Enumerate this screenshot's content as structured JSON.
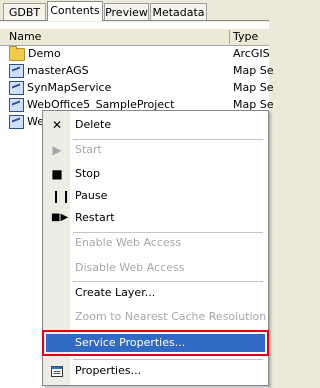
{
  "tabs": [
    {
      "label": "GDBT"
    },
    {
      "label": "Contents"
    },
    {
      "label": "Preview"
    },
    {
      "label": "Metadata"
    }
  ],
  "active_tab": "Contents",
  "columns": {
    "name": "Name",
    "type": "Type"
  },
  "rows": [
    {
      "name": "Demo",
      "type": "ArcGIS",
      "icon": "folder-icon"
    },
    {
      "name": "masterAGS",
      "type": "Map Se",
      "icon": "map-service-icon"
    },
    {
      "name": "SynMapService",
      "type": "Map Se",
      "icon": "map-service-icon"
    },
    {
      "name": "WebOffice5_SampleProject",
      "type": "Map Se",
      "icon": "map-service-icon"
    },
    {
      "name": "Web",
      "type": "",
      "icon": "map-service-icon"
    }
  ],
  "menu": {
    "items": [
      {
        "label": "Delete",
        "icon": "x",
        "enabled": true
      },
      {
        "label": "Start",
        "icon": "play",
        "enabled": false
      },
      {
        "label": "Stop",
        "icon": "stop",
        "enabled": true
      },
      {
        "label": "Pause",
        "icon": "pause",
        "enabled": true
      },
      {
        "label": "Restart",
        "icon": "restart",
        "enabled": true
      },
      {
        "label": "Enable Web Access",
        "enabled": false
      },
      {
        "label": "Disable Web Access",
        "enabled": false
      },
      {
        "label": "Create Layer...",
        "enabled": true
      },
      {
        "label": "Zoom to Nearest Cache Resolution",
        "enabled": false
      },
      {
        "label": "Service Properties...",
        "enabled": true,
        "highlighted": true
      },
      {
        "label": "Properties...",
        "icon": "properties",
        "enabled": true
      }
    ]
  },
  "colors": {
    "highlight": "#316ac5",
    "outline": "#e0001a",
    "disabled": "#a7a6aa"
  }
}
